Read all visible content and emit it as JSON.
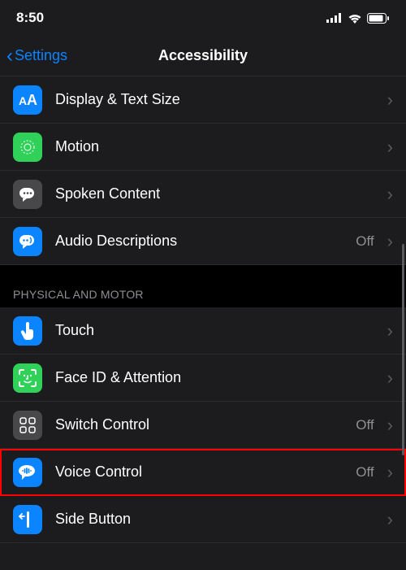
{
  "status": {
    "time": "8:50"
  },
  "nav": {
    "back_label": "Settings",
    "title": "Accessibility"
  },
  "sections": {
    "vision_items": {
      "display_text_size": {
        "label": "Display & Text Size"
      },
      "motion": {
        "label": "Motion"
      },
      "spoken_content": {
        "label": "Spoken Content"
      },
      "audio_descriptions": {
        "label": "Audio Descriptions",
        "value": "Off"
      }
    },
    "physical_header": "Physical and Motor",
    "physical_items": {
      "touch": {
        "label": "Touch"
      },
      "face_id": {
        "label": "Face ID & Attention"
      },
      "switch_control": {
        "label": "Switch Control",
        "value": "Off"
      },
      "voice_control": {
        "label": "Voice Control",
        "value": "Off"
      },
      "side_button": {
        "label": "Side Button"
      }
    }
  }
}
